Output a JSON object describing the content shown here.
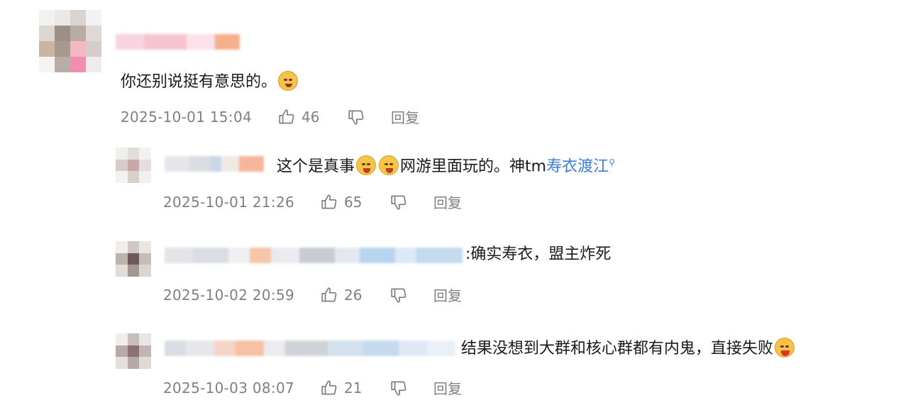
{
  "comments": [
    {
      "text": "你还别说挺有意思的。",
      "emoji": "cat-face-emoji",
      "date": "2025-10-01 15:04",
      "likes": "46",
      "reply_label": "回复"
    },
    {
      "text_before": "这个是真事",
      "emoji": "laugh-cry-emoji",
      "text_after": "网游里面玩的。神tm",
      "link": "寿衣渡江",
      "link_icon": "search-icon",
      "date": "2025-10-01 21:26",
      "likes": "65",
      "reply_label": "回复"
    },
    {
      "text": ":确实寿衣，盟主炸死",
      "date": "2025-10-02 20:59",
      "likes": "26",
      "reply_label": "回复"
    },
    {
      "text": "结果没想到大群和核心群都有内鬼，直接失败",
      "emoji": "tongue-face-emoji",
      "date": "2025-10-03 08:07",
      "likes": "21",
      "reply_label": "回复"
    }
  ],
  "colors": {
    "link": "#3d7ed6",
    "meta": "#808080",
    "text": "#1a1a1a"
  }
}
